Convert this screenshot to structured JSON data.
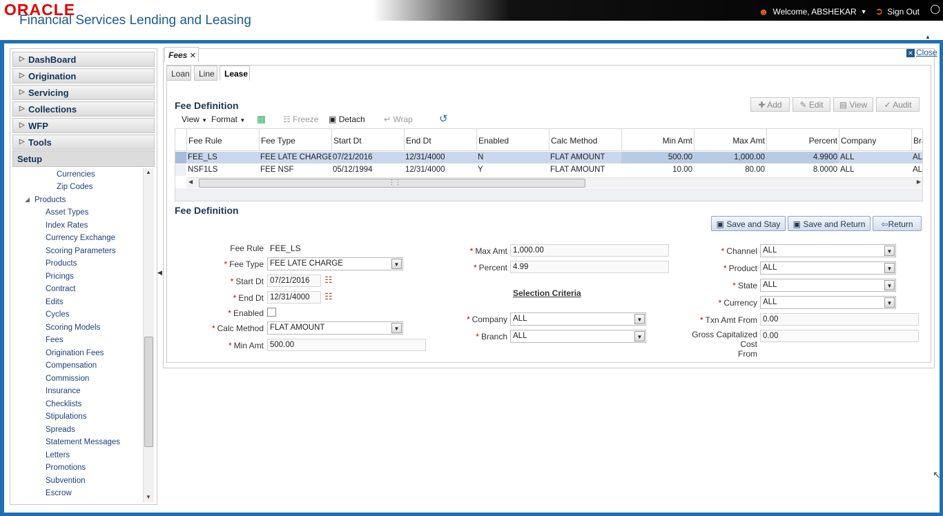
{
  "header": {
    "logo": "ORACLE",
    "app_title": "Financial Services Lending and Leasing",
    "welcome": "Welcome, ABSHEKAR",
    "sign_out": "Sign Out"
  },
  "sidebar": {
    "items": [
      {
        "label": "DashBoard"
      },
      {
        "label": "Origination"
      },
      {
        "label": "Servicing"
      },
      {
        "label": "Collections"
      },
      {
        "label": "WFP"
      },
      {
        "label": "Tools"
      }
    ],
    "setup": "Setup",
    "tree": [
      "Currencies",
      "Zip Codes",
      "Products",
      "Asset Types",
      "Index Rates",
      "Currency Exchange",
      "Scoring Parameters",
      "Products",
      "Pricings",
      "Contract",
      "Edits",
      "Cycles",
      "Scoring Models",
      "Fees",
      "Origination Fees",
      "Compensation",
      "Commission",
      "Insurance",
      "Checklists",
      "Stipulations",
      "Spreads",
      "Statement Messages",
      "Letters",
      "Promotions",
      "Subvention",
      "Escrow"
    ]
  },
  "main": {
    "tab": "Fees",
    "close": "Close",
    "subtabs": [
      "Loan",
      "Line",
      "Lease"
    ],
    "section1": "Fee Definition",
    "section2": "Fee Definition",
    "actions": {
      "add": "Add",
      "edit": "Edit",
      "view": "View",
      "audit": "Audit"
    },
    "toolbar": {
      "view": "View",
      "format": "Format",
      "freeze": "Freeze",
      "detach": "Detach",
      "wrap": "Wrap"
    },
    "columns": [
      "Fee Rule",
      "Fee Type",
      "Start Dt",
      "End Dt",
      "Enabled",
      "Calc Method",
      "Min Amt",
      "Max Amt",
      "Percent",
      "Company",
      "Bra"
    ],
    "rows": [
      [
        "FEE_LS",
        "FEE LATE CHARGE",
        "07/21/2016",
        "12/31/4000",
        "N",
        "FLAT AMOUNT",
        "500.00",
        "1,000.00",
        "4.9900",
        "ALL",
        "ALL"
      ],
      [
        "NSF1LS",
        "FEE NSF",
        "05/12/1994",
        "12/31/4000",
        "Y",
        "FLAT AMOUNT",
        "10.00",
        "80.00",
        "8.0000",
        "ALL",
        "ALL"
      ]
    ],
    "buttons": {
      "save_stay": "Save and Stay",
      "save_return": "Save and Return",
      "return": "Return"
    }
  },
  "form": {
    "fee_rule_label": "Fee Rule",
    "fee_rule": "FEE_LS",
    "fee_type_label": "Fee Type",
    "fee_type": "FEE LATE CHARGE",
    "start_dt_label": "Start Dt",
    "start_dt": "07/21/2016",
    "end_dt_label": "End Dt",
    "end_dt": "12/31/4000",
    "enabled_label": "Enabled",
    "calc_method_label": "Calc Method",
    "calc_method": "FLAT AMOUNT",
    "min_amt_label": "Min Amt",
    "min_amt": "500.00",
    "max_amt_label": "Max Amt",
    "max_amt": "1,000.00",
    "percent_label": "Percent",
    "percent": "4.99",
    "selection_criteria": "Selection Criteria",
    "company_label": "Company",
    "company": "ALL",
    "branch_label": "Branch",
    "branch": "ALL",
    "channel_label": "Channel",
    "channel": "ALL",
    "product_label": "Product",
    "product": "ALL",
    "state_label": "State",
    "state": "ALL",
    "currency_label": "Currency",
    "currency": "ALL",
    "txn_amt_from_label": "Txn Amt From",
    "txn_amt_from": "0.00",
    "gross_cap_label_1": "Gross Capitalized Cost",
    "gross_cap_label_2": "From",
    "gross_cap": "0.00"
  },
  "colors": {
    "frame": "#1f6fb5",
    "nav_text": "#13325c",
    "selected_row": "#c9d8ec",
    "logo_red": "#e30000"
  }
}
